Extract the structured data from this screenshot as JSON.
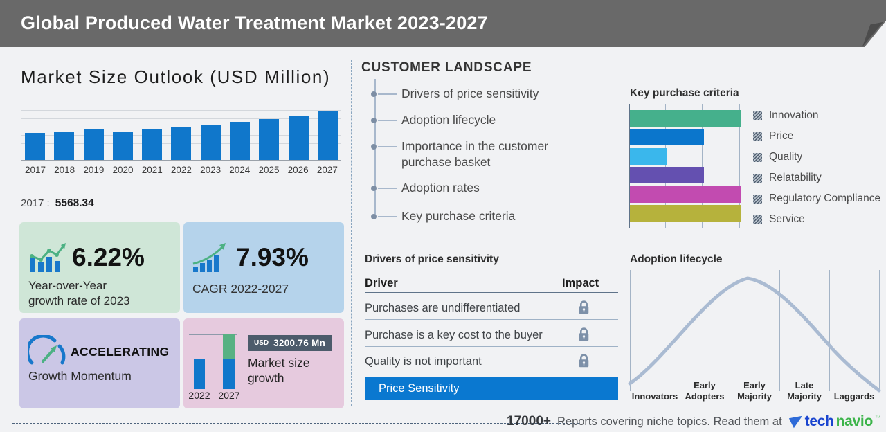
{
  "header": {
    "title": "Global Produced Water Treatment Market 2023-2027"
  },
  "market_size": {
    "title": "Market Size Outlook (USD Million)",
    "base_year_label": "2017 :",
    "base_year_value": "5568.34"
  },
  "stats": {
    "yoy": {
      "value": "6.22%",
      "caption_line1": "Year-over-Year",
      "caption_line2": "growth rate of 2023"
    },
    "cagr": {
      "value": "7.93%",
      "caption": "CAGR 2022-2027"
    },
    "momentum": {
      "word": "ACCELERATING",
      "caption": "Growth Momentum"
    },
    "growth": {
      "badge_currency": "USD",
      "badge_value": "3200.76 Mn",
      "caption_line1": "Market size",
      "caption_line2": "growth",
      "year_start": "2022",
      "year_end": "2027"
    }
  },
  "customer_landscape": {
    "title": "CUSTOMER LANDSCAPE",
    "items": [
      "Drivers of price sensitivity",
      "Adoption lifecycle",
      "Importance in the customer purchase basket",
      "Adoption rates",
      "Key purchase criteria"
    ]
  },
  "drivers_table": {
    "title": "Drivers of price sensitivity",
    "col_driver": "Driver",
    "col_impact": "Impact",
    "rows": [
      "Purchases are undifferentiated",
      "Purchase is a key cost to the buyer",
      "Quality is not important"
    ],
    "highlight_row": "Price Sensitivity"
  },
  "footer": {
    "count": "17000+",
    "text": "Reports covering niche topics. Read them at",
    "brand_part1": "tech",
    "brand_part2": "navio"
  },
  "colors": {
    "banner": "#696969",
    "bar_blue": "#1077cb",
    "stat_green_bg": "#cfe6d7",
    "stat_blue_bg": "#b5d3eb",
    "stat_purple_bg": "#cbc7e6",
    "stat_pink_bg": "#e6cade",
    "badge_bg": "#4c5b6b",
    "highlight_blue": "#0a78d0",
    "icon_green": "#4cb183",
    "icon_blue": "#1878cb",
    "lock_gray": "#7d90a8",
    "curve": "#aabbd2",
    "brand_blue": "#1b45cf",
    "brand_green": "#3cb44a"
  },
  "chart_data": [
    {
      "type": "bar",
      "title": "Market Size Outlook (USD Million)",
      "categories": [
        "2017",
        "2018",
        "2019",
        "2020",
        "2021",
        "2022",
        "2023",
        "2024",
        "2025",
        "2026",
        "2027"
      ],
      "values": [
        5568.34,
        5850,
        6280,
        5860,
        6300,
        6890,
        7320,
        7860,
        8460,
        9180,
        10090
      ],
      "ylabel": "USD Million",
      "ylim": [
        0,
        12000
      ],
      "grid": true,
      "bar_color": "#1077cb",
      "labeled_values": {
        "2017": 5568.34
      },
      "note": "only 2017 labeled; other values estimated from bar heights"
    },
    {
      "type": "bar",
      "orientation": "horizontal",
      "title": "Key purchase criteria",
      "categories": [
        "Innovation",
        "Price",
        "Quality",
        "Relatability",
        "Regulatory Compliance",
        "Service"
      ],
      "values": [
        3,
        2,
        1,
        2,
        3,
        3
      ],
      "xlim": [
        0,
        3
      ],
      "grid": true,
      "colors": [
        "#45b08c",
        "#0b76cc",
        "#3ab7ec",
        "#6450b0",
        "#c24bb0",
        "#b6b23c"
      ],
      "legend_position": "right",
      "note": "no numeric axis labels shown; values in gridline units"
    },
    {
      "type": "line",
      "title": "Adoption lifecycle",
      "categories": [
        "Innovators",
        "Early Adopters",
        "Early Majority",
        "Late Majority",
        "Laggards"
      ],
      "description": "bell curve over five adopter segments, peak within Early Majority",
      "line_color": "#aabbd2"
    },
    {
      "type": "bar",
      "title": "Market size growth",
      "categories": [
        "2022",
        "2027"
      ],
      "badge": "USD 3200.76 Mn",
      "description": "2027 bar equals 2022 bar plus green increment of USD 3200.76 Mn"
    }
  ]
}
